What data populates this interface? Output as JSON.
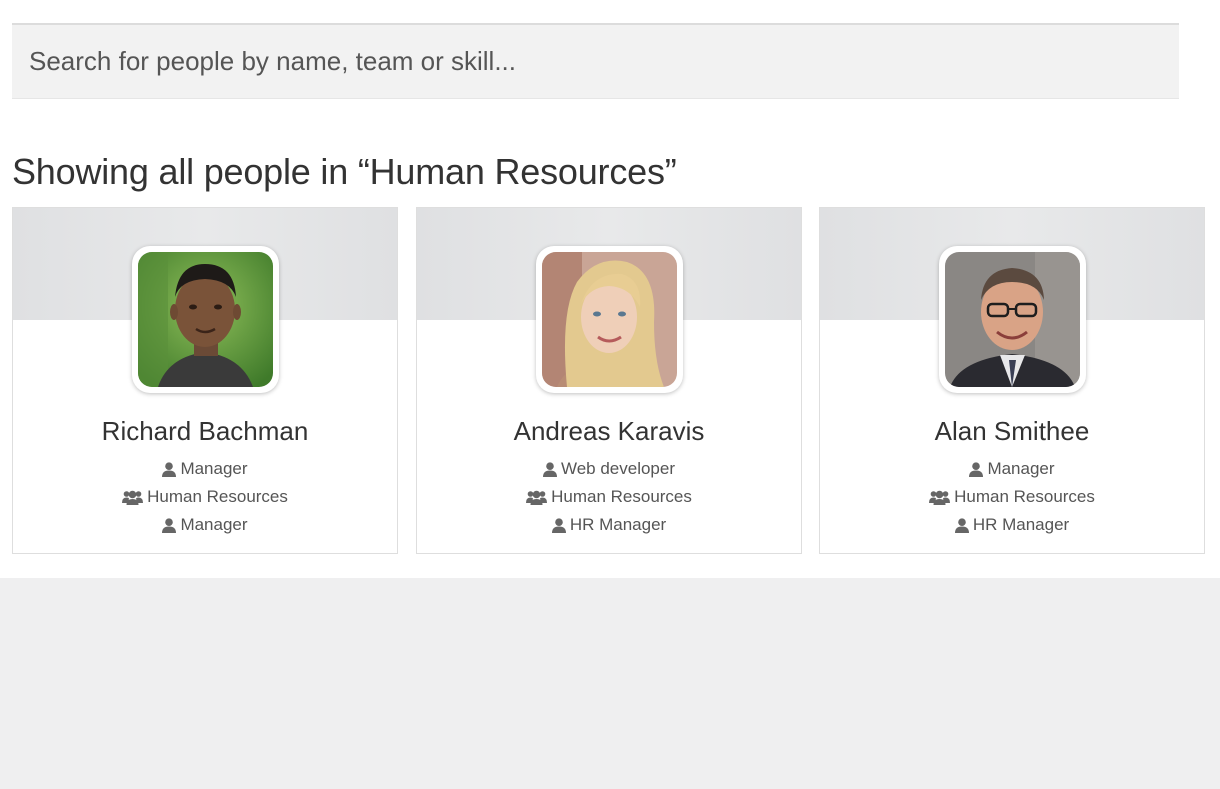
{
  "search": {
    "placeholder": "Search for people by name, team or skill..."
  },
  "heading": "Showing all people in “Human Resources”",
  "colors": {
    "banner": "#e1e2e4",
    "footer_background": "#efeff0",
    "icon": "#666666"
  },
  "people": [
    {
      "name": "Richard Bachman",
      "title": "Manager",
      "team": "Human Resources",
      "role": "Manager",
      "photo": "portrait-man-green-background"
    },
    {
      "name": "Andreas Karavis",
      "title": "Web developer",
      "team": "Human Resources",
      "role": "HR Manager",
      "photo": "portrait-woman-blonde"
    },
    {
      "name": "Alan Smithee",
      "title": "Manager",
      "team": "Human Resources",
      "role": "HR Manager",
      "photo": "portrait-man-glasses-suit"
    }
  ]
}
